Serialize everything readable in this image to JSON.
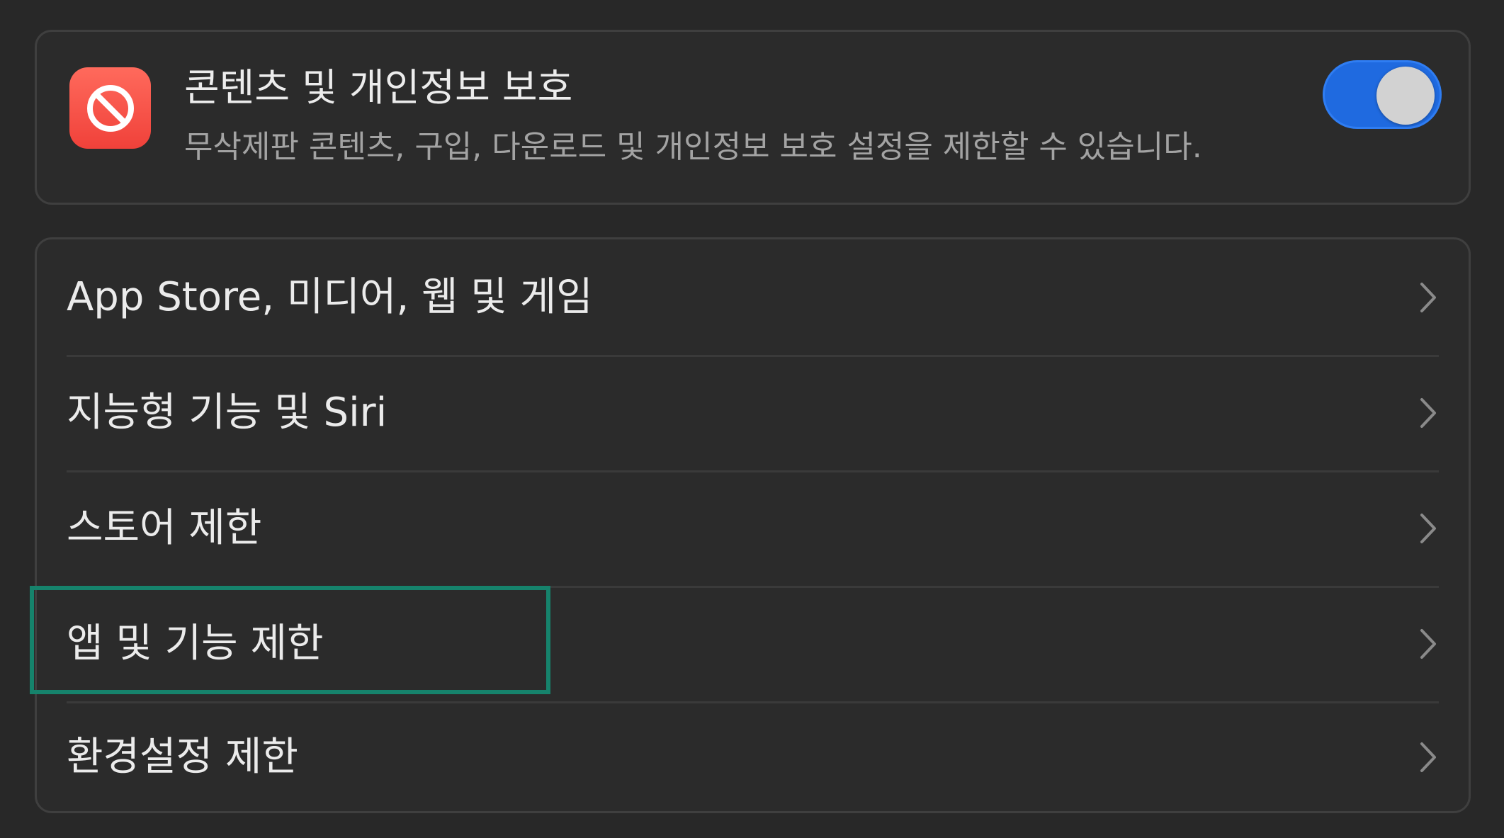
{
  "header": {
    "icon": "prohibited-icon",
    "title": "콘텐츠 및 개인정보 보호",
    "description": "무삭제판 콘텐츠, 구입, 다운로드 및 개인정보 보호 설정을 제한할 수 있습니다.",
    "toggle_on": true,
    "toggle_color": "#1f6ae0"
  },
  "list": {
    "items": [
      {
        "label": "App Store, 미디어, 웹 및 게임"
      },
      {
        "label": "지능형 기능 및 Siri"
      },
      {
        "label": "스토어 제한"
      },
      {
        "label": "앱 및 기능 제한"
      },
      {
        "label": "환경설정 제한"
      }
    ]
  },
  "highlight": {
    "target": "앱 및 기능 제한",
    "color": "#16836c"
  }
}
